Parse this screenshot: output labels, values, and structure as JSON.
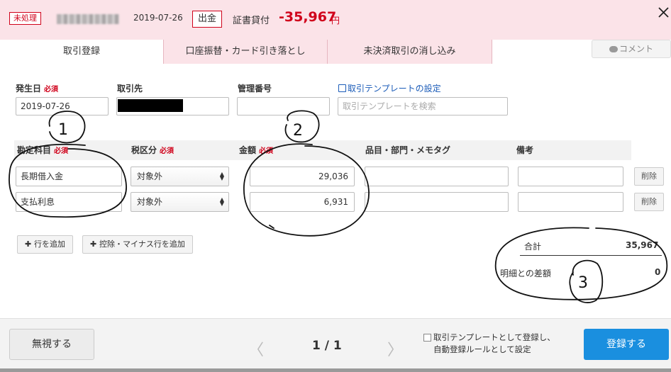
{
  "header": {
    "status": "未処理",
    "date": "2019-07-26",
    "type": "出金",
    "account": "証書貸付",
    "amount": "-35,967",
    "currency": "円"
  },
  "tabs": [
    {
      "label": "取引登録"
    },
    {
      "label": "口座振替・カード引き落とし"
    },
    {
      "label": "未決済取引の消し込み"
    }
  ],
  "comment_label": "コメント",
  "form": {
    "date_label": "発生日",
    "partner_label": "取引先",
    "mgmt_label": "管理番号",
    "required": "必須",
    "date_value": "2019-07-26",
    "template_link": "取引テンプレートの設定",
    "template_placeholder": "取引テンプレートを検索"
  },
  "table": {
    "headers": [
      "勘定科目",
      "税区分",
      "金額",
      "品目・部門・メモタグ",
      "備考"
    ],
    "rows": [
      {
        "account": "長期借入金",
        "tax": "対象外",
        "amount": "29,036",
        "delete": "削除"
      },
      {
        "account": "支払利息",
        "tax": "対象外",
        "amount": "6,931",
        "delete": "削除"
      }
    ]
  },
  "add_row": "行を追加",
  "add_deduction_row": "控除・マイナス行を追加",
  "totals": {
    "total_label": "合計",
    "total_value": "35,967",
    "diff_label": "明細との差額",
    "diff_value": "0"
  },
  "footer": {
    "ignore": "無視する",
    "page": "1 / 1",
    "template_check_line1": "取引テンプレートとして登録し、",
    "template_check_line2": "自動登録ルールとして設定",
    "register": "登録する"
  },
  "annotations": [
    "1",
    "2",
    "3"
  ]
}
